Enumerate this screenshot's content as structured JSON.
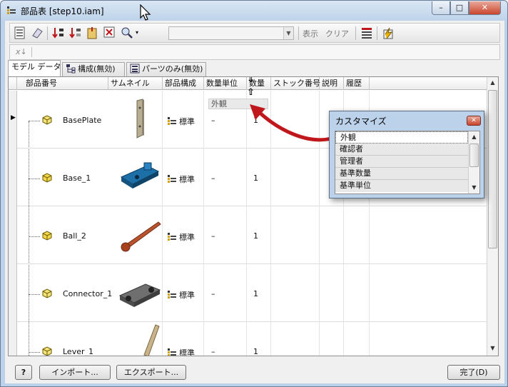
{
  "window": {
    "title": "部品表 [step10.iam]"
  },
  "toolbar": {
    "show_label": "表示",
    "clear_label": "クリア",
    "combo_value": ""
  },
  "formula": {
    "symbol": "x↓"
  },
  "tabs": [
    {
      "label": "モデル データ"
    },
    {
      "label": "構成(無効)"
    },
    {
      "label": "パーツのみ(無効)"
    }
  ],
  "columns": [
    "部品番号",
    "サムネイル",
    "部品構成",
    "数量単位",
    "数量",
    "ストック番号",
    "説明",
    "履歴"
  ],
  "drop_tag": "外観",
  "rows": [
    {
      "part_number": "BasePlate",
      "bom": "標準",
      "unit": "–",
      "qty": "1"
    },
    {
      "part_number": "Base_1",
      "bom": "標準",
      "unit": "–",
      "qty": "1"
    },
    {
      "part_number": "Ball_2",
      "bom": "標準",
      "unit": "–",
      "qty": "1"
    },
    {
      "part_number": "Connector_1",
      "bom": "標準",
      "unit": "–",
      "qty": "1"
    },
    {
      "part_number": "Lever_1",
      "bom": "標準",
      "unit": "–",
      "qty": "1"
    }
  ],
  "customize": {
    "title": "カスタマイズ",
    "items": [
      "外観",
      "確認者",
      "管理者",
      "基準数量",
      "基準単位"
    ]
  },
  "footer": {
    "help_label": "?",
    "import_label": "インポート...",
    "export_label": "エクスポート...",
    "done_label": "完了(D)"
  },
  "colors": {
    "accent_red": "#c0171c",
    "window_frame": "#bcd1ea"
  }
}
